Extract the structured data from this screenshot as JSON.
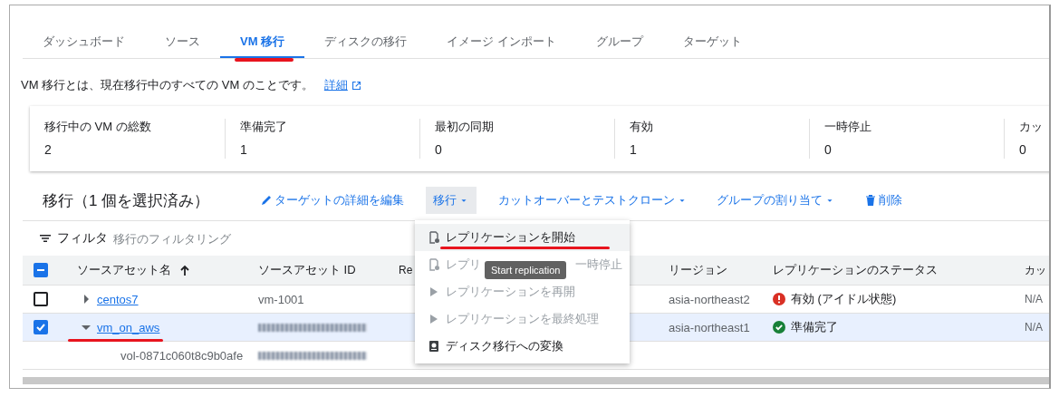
{
  "tabs": [
    {
      "label": "ダッシュボード",
      "selected": false,
      "annotated": false
    },
    {
      "label": "ソース",
      "selected": false,
      "annotated": false
    },
    {
      "label": "VM 移行",
      "selected": true,
      "annotated": true
    },
    {
      "label": "ディスクの移行",
      "selected": false,
      "annotated": false
    },
    {
      "label": "イメージ インポート",
      "selected": false,
      "annotated": false
    },
    {
      "label": "グループ",
      "selected": false,
      "annotated": false
    },
    {
      "label": "ターゲット",
      "selected": false,
      "annotated": false
    }
  ],
  "description": {
    "text": "VM 移行とは、現在移行中のすべての VM のことです。",
    "link": "詳細"
  },
  "stats": [
    {
      "label": "移行中の VM の総数",
      "value": "2"
    },
    {
      "label": "準備完了",
      "value": "1"
    },
    {
      "label": "最初の同期",
      "value": "0"
    },
    {
      "label": "有効",
      "value": "1"
    },
    {
      "label": "一時停止",
      "value": "0"
    },
    {
      "label": "カッ",
      "value": "0"
    }
  ],
  "toolbar": {
    "title": "移行（1 個を選択済み）",
    "actions": [
      {
        "label": "ターゲットの詳細を編集",
        "kind": "edit",
        "open": false
      },
      {
        "label": "移行",
        "kind": "dropdown",
        "open": true
      },
      {
        "label": "カットオーバーとテストクローン",
        "kind": "dropdown",
        "open": false
      },
      {
        "label": "グループの割り当て",
        "kind": "dropdown",
        "open": false
      },
      {
        "label": "削除",
        "kind": "delete",
        "open": false
      }
    ]
  },
  "filter": {
    "label": "フィルタ",
    "placeholder": "移行のフィルタリング"
  },
  "table": {
    "header_checkbox": {
      "indeterminate": true
    },
    "columns": [
      {
        "label": "ソースアセット名",
        "sorted": true
      },
      {
        "label": "ソースアセット ID"
      },
      {
        "label": "Re"
      },
      {
        "label": "リージョン"
      },
      {
        "label": "レプリケーションのステータス"
      },
      {
        "label": "カッ"
      }
    ],
    "rows": [
      {
        "checked": false,
        "selected": false,
        "expanded": false,
        "name": "centos7",
        "annotated": false,
        "id": "vm-1001",
        "id_blurred": false,
        "region": "asia-northeast2",
        "status": {
          "kind": "error",
          "text": "有効 (アイドル状態)"
        },
        "column_6": "N/A",
        "children": []
      },
      {
        "checked": true,
        "selected": true,
        "expanded": true,
        "name": "vm_on_aws",
        "annotated": true,
        "id_blurred": true,
        "region": "asia-northeast1",
        "status": {
          "kind": "ok",
          "text": "準備完了"
        },
        "column_6": "N/A",
        "children": [
          {
            "name": "vol-0871c060t8c9b0afe",
            "id_blurred": true
          }
        ]
      }
    ]
  },
  "menu": {
    "items": [
      {
        "kind": "start",
        "label": "レプリケーションを開始",
        "disabled": false,
        "hovered": true,
        "annotated": true
      },
      {
        "kind": "pause",
        "label_parts": [
          "レプリ",
          "一時停止"
        ],
        "disabled": true,
        "hovered": false,
        "annotated": false
      },
      {
        "kind": "resume",
        "label": "レプリケーションを再開",
        "disabled": true,
        "hovered": false,
        "annotated": false
      },
      {
        "kind": "finalize",
        "label": "レプリケーションを最終処理",
        "disabled": true,
        "hovered": false,
        "annotated": false
      },
      {
        "kind": "convert",
        "label": "ディスク移行への変換",
        "disabled": false,
        "hovered": false,
        "annotated": false
      }
    ]
  },
  "tooltip": {
    "text": "Start replication"
  }
}
